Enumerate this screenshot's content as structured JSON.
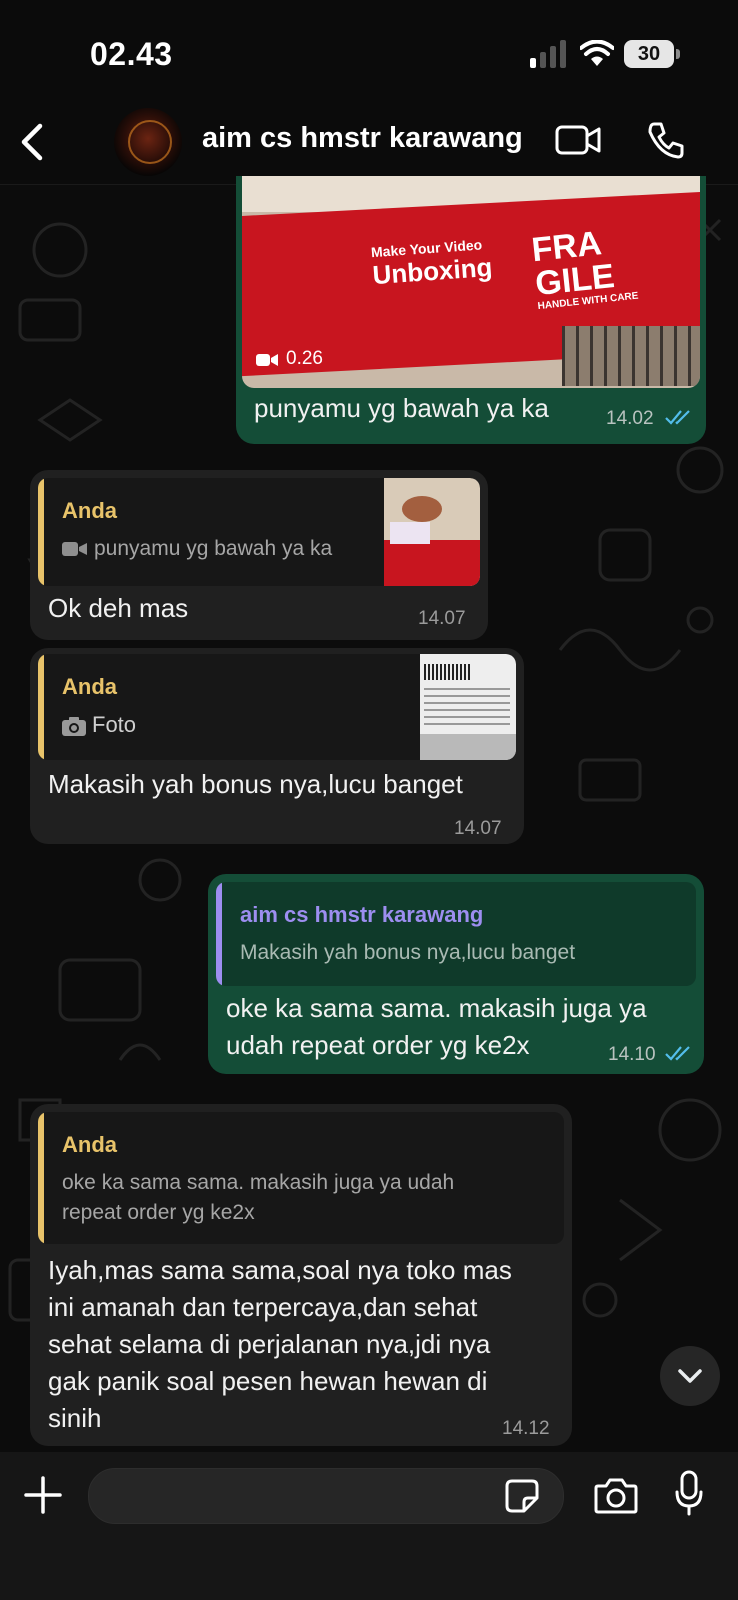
{
  "status_bar": {
    "time": "02.43",
    "battery": "30"
  },
  "header": {
    "contact_name": "aim cs hmstr karawang"
  },
  "messages": [
    {
      "direction": "outgoing",
      "type": "video",
      "video_duration": "0.26",
      "video_overlay_text": {
        "make": "Make Your Video",
        "unboxing": "Unboxing",
        "fra": "FRA",
        "gile": "GILE",
        "handle": "HANDLE WITH CARE"
      },
      "text": "punyamu yg bawah ya ka",
      "time": "14.02",
      "status": "read"
    },
    {
      "direction": "incoming",
      "quote": {
        "author": "Anda",
        "preview": "punyamu yg bawah ya ka",
        "preview_icon": "video-icon"
      },
      "text": "Ok deh mas",
      "time": "14.07"
    },
    {
      "direction": "incoming",
      "quote": {
        "author": "Anda",
        "preview": "Foto",
        "preview_icon": "camera-icon"
      },
      "text": "Makasih yah bonus nya,lucu banget",
      "time": "14.07"
    },
    {
      "direction": "outgoing",
      "quote": {
        "author": "aim cs hmstr karawang",
        "preview": "Makasih yah bonus nya,lucu banget"
      },
      "text_lines": [
        "oke ka sama sama. makasih juga ya",
        "udah repeat order yg ke2x"
      ],
      "time": "14.10",
      "status": "read"
    },
    {
      "direction": "incoming",
      "quote": {
        "author": "Anda",
        "preview_lines": [
          "oke ka sama sama. makasih juga ya udah",
          "repeat order yg ke2x"
        ]
      },
      "text_lines": [
        "Iyah,mas sama sama,soal nya toko mas",
        "ini amanah dan terpercaya,dan sehat",
        "sehat selama di perjalanan nya,jdi nya",
        "gak panik soal pesen hewan hewan di",
        "sinih"
      ],
      "time": "14.12"
    }
  ],
  "colors": {
    "outgoing_bubble": "#144d37",
    "incoming_bubble": "#202020",
    "quote_anda": "#e8c36a",
    "quote_contact": "#9d8ef0",
    "read_tick": "#53bdeb"
  }
}
